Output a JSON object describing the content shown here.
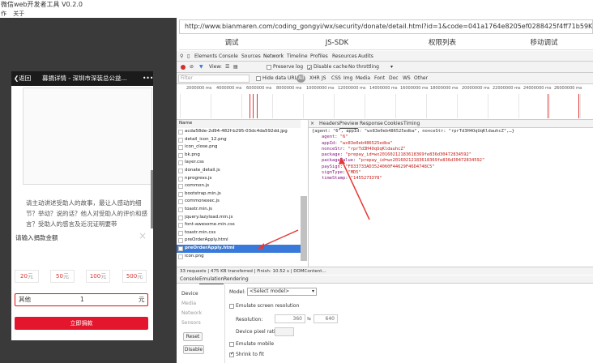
{
  "window": {
    "title": "微信web开发者工具 V0.2.0"
  },
  "menu": [
    "作",
    "关于"
  ],
  "phone": {
    "back_label": "返回",
    "title": "募捐详情 - 深圳市深装总公益...",
    "more": "•••",
    "story_text": "请主动讲述受助人的故事，最让人感动的细节？举动？说的话？他人对受助人的评价和感言？受助人的感言及近况证明要带",
    "dialog_title": "请输入捐款金额",
    "close": "×",
    "amounts": [
      {
        "value": "20",
        "unit": "元"
      },
      {
        "value": "50",
        "unit": "元"
      },
      {
        "value": "100",
        "unit": "元"
      },
      {
        "value": "500",
        "unit": "元"
      }
    ],
    "input_label": "其他",
    "input_value": "1",
    "input_unit": "元",
    "submit_label": "立即捐款"
  },
  "url": "http://www.bianmaren.com/coding_gongyi/wx/security/donate/detail.html?id=1&code=041a1764e8205ef0288425f4ff71b59K&state=STATE",
  "main_tabs": [
    "调试",
    "JS-SDK",
    "权限列表",
    "移动调试"
  ],
  "devtools": {
    "tabs": [
      "Elements",
      "Console",
      "Sources",
      "Network",
      "Timeline",
      "Profiles",
      "Resources",
      "Audits"
    ],
    "active_tab": "Network",
    "toolbar": {
      "view_label": "View:",
      "preserve_log": "Preserve log",
      "disable_cache": "Disable cache",
      "throttling": "No throttling"
    },
    "filter": {
      "placeholder": "Filter",
      "hide_data_urls": "Hide data URLs",
      "types": [
        "All",
        "XHR",
        "JS",
        "CSS",
        "Img",
        "Media",
        "Font",
        "Doc",
        "WS",
        "Other"
      ]
    },
    "timeline_ticks": [
      "2000000 ms",
      "4000000 ms",
      "6000000 ms",
      "8000000 ms",
      "10000000 ms",
      "12000000 ms",
      "14000000 ms",
      "16000000 ms",
      "18000000 ms",
      "20000000 ms",
      "22000000 ms",
      "24000000 ms",
      "26000000 ms"
    ],
    "name_header": "Name",
    "files": [
      "acda58de-2d94-482f-b295-03dc4da592dd.jpg",
      "detail_icon_12.png",
      "icon_close.png",
      "bk.png",
      "layer.css",
      "donate_detail.js",
      "nprogress.js",
      "common.js",
      "bootstrap.min.js",
      "commonexec.js",
      "toastr.min.js",
      "jquery.lazyload.min.js",
      "font-awesome.min.css",
      "toastr.min.css",
      "preOrderApply.html",
      "preOrderApply.html",
      "icon.png"
    ],
    "selected_index": 15,
    "detail_tabs": [
      "Headers",
      "Preview",
      "Response",
      "Cookies",
      "Timing"
    ],
    "response": {
      "summary": "{agent: \"6\", appId: \"wx83e0eb486525edba\", nonceStr: \"rprTd3H4OqUqKldauhcZ\",…}",
      "fields": [
        {
          "key": "agent",
          "value": "\"6\""
        },
        {
          "key": "appId",
          "value": "\"wx83e0eb486525edba\""
        },
        {
          "key": "nonceStr",
          "value": "\"rprTd3H4OqUqKldauhcZ\""
        },
        {
          "key": "package",
          "value": "\"prepay_id=wx20160212183618369fe836d30472834592\""
        },
        {
          "key": "packageValue",
          "value": "\"prepay_id=wx20160212183618369fe836d30472834592\""
        },
        {
          "key": "paySign",
          "value": "\"F833733AD3524060F44629F46D4748C5\""
        },
        {
          "key": "signType",
          "value": "\"MD5\""
        },
        {
          "key": "timeStamp",
          "value": "\"1455273378\""
        }
      ]
    },
    "status": "33 requests | 475 KB transferred | Finish: 10.52 s | DOMContent...",
    "drawer_tabs": [
      "Console",
      "Emulation",
      "Rendering"
    ],
    "emulation": {
      "side_items": [
        "Device",
        "Media",
        "Network",
        "Sensors"
      ],
      "reset": "Reset",
      "disable": "Disable",
      "model_label": "Model:",
      "model_value": "<Select model>",
      "emulate_resolution": "Emulate screen resolution",
      "resolution_label": "Resolution:",
      "res_w": "360",
      "res_h": "640",
      "dpr_label": "Device pixel ratio:",
      "emulate_mobile": "Emulate mobile",
      "shrink": "Shrink to fit"
    }
  },
  "colors": {
    "accent_red": "#e4162d",
    "arrow_red": "#e53935",
    "select_blue": "#3879d9"
  }
}
